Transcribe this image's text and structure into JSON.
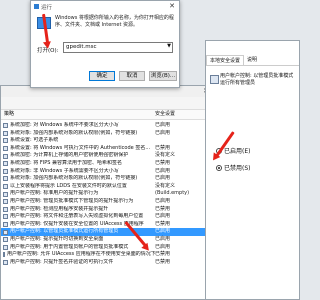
{
  "run": {
    "title": "运行",
    "description": "Windows 将根据你所输入的名称，为你打开相应的程序、文件夹、文档或 Internet 资源。",
    "open_label": "打开(O):",
    "open_value": "gpedit.msc",
    "ok": "确定",
    "cancel": "取消",
    "browse": "浏览(B)..."
  },
  "editor": {
    "columns": {
      "name": "策略",
      "state": "安全设置"
    },
    "rows": [
      {
        "name": "系统加密: 对 Windows 系统中不要求区分大小写",
        "state": "已启用"
      },
      {
        "name": "系统对象: 加强内部系统对象的默认权限(例如，符号链接)",
        "state": "已启用"
      },
      {
        "name": "系统设置: 可选子系统",
        "state": ""
      },
      {
        "name": "系统设置: 将 Windows 可执行文件中的 Authenticode 签名...",
        "state": "已禁用"
      },
      {
        "name": "系统加密: 为计算机上存储的用户密钥使用强密钥保护",
        "state": "没有定义"
      },
      {
        "name": "系统加密: 将 FIPS 兼容算法用于加密、哈希和签名",
        "state": "已禁用"
      },
      {
        "name": "系统对象: 非 Windows 子系统需要不区分大小写",
        "state": "已启用"
      },
      {
        "name": "系统对象: 加强内部系统对象的默认权限(例如，符号链接)",
        "state": "已启用"
      },
      {
        "name": "以上安装程序将提示 LDDS 在安装文件时的默认位置",
        "state": "没有定义"
      },
      {
        "name": "用户帐户控制: 标准用户的提升提示行为",
        "state": "(Build.empty)"
      },
      {
        "name": "用户帐户控制: 管理员批准模式下管理员的提升提示行为",
        "state": "已启用"
      },
      {
        "name": "用户帐户控制: 检测应用程序安装并提示提升",
        "state": "已禁用"
      },
      {
        "name": "用户帐户控制: 将文件和注册表写入失败虚拟化到每用户位置",
        "state": "已启用"
      },
      {
        "name": "用户帐户控制: 仅提升安装在安全位置的 UIAccess 应用程序",
        "state": "已禁用"
      },
      {
        "name": "用户帐户控制: 以管理员批准模式运行所有管理员",
        "state": "已启用",
        "selected": true
      },
      {
        "name": "用户帐户控制: 提示提升时切换到安全桌面",
        "state": "已启用"
      },
      {
        "name": "用户帐户控制: 用于内置管理员帐户的管理员批准模式",
        "state": "已启用"
      },
      {
        "name": "用户帐户控制: 允许 UIAccess 应用程序在不使用安全桌面的情况下提示提升",
        "state": "已禁用"
      },
      {
        "name": "用户帐户控制: 只提升签名并验证的可执行文件",
        "state": "已禁用"
      }
    ]
  },
  "props": {
    "tab_local": "本地安全设置",
    "tab_explain": "说明",
    "policy_title": "用户帐户控制: 以管理员批准模式运行所有管理员",
    "enabled_label": "已启用(E)",
    "disabled_label": "已禁用(S)"
  },
  "colors": {
    "accent": "#3399ff",
    "arrow": "#e5231a"
  }
}
